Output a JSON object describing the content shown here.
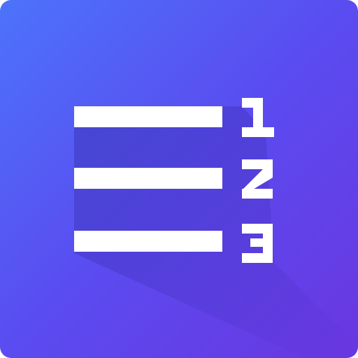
{
  "icon": {
    "name": "numbered-list-app-icon",
    "numbers": [
      "1",
      "2",
      "3"
    ],
    "colors": {
      "gradient_start": "#4C73FB",
      "gradient_mid": "#5A4CF0",
      "gradient_end": "#6A36E0",
      "glyph": "#FFFFFF",
      "shadow": "#2A1C8E"
    }
  }
}
